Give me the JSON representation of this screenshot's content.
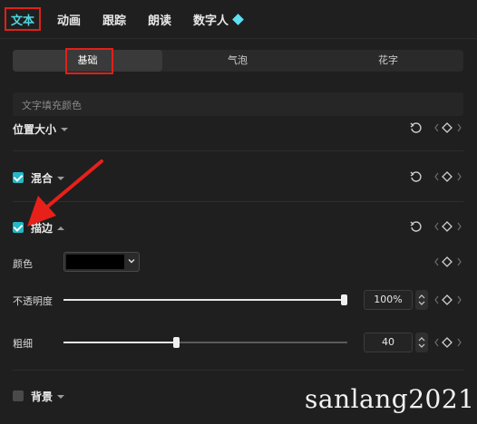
{
  "tabs": [
    {
      "label": "文本",
      "active": true
    },
    {
      "label": "动画"
    },
    {
      "label": "跟踪"
    },
    {
      "label": "朗读"
    },
    {
      "label": "数字人"
    }
  ],
  "segments": [
    {
      "label": "基础",
      "active": true
    },
    {
      "label": "气泡"
    },
    {
      "label": "花字"
    }
  ],
  "fill_color_placeholder": "文字填充颜色",
  "sections": {
    "position_size": {
      "title": "位置大小"
    },
    "blend": {
      "title": "混合",
      "checked": true
    },
    "stroke": {
      "title": "描边",
      "checked": true
    },
    "background": {
      "title": "背景",
      "checked": false
    }
  },
  "stroke": {
    "color_label": "颜色",
    "color_value": "#000000",
    "opacity_label": "不透明度",
    "opacity_value": "100%",
    "opacity_fraction": 1.0,
    "thickness_label": "粗细",
    "thickness_value": "40",
    "thickness_fraction": 0.4
  },
  "watermark": "sanlang2021",
  "colors": {
    "accent": "#4fd6e0",
    "highlight": "#e0201a",
    "checkbox": "#23b8c8",
    "arrow": "#e8201a"
  }
}
